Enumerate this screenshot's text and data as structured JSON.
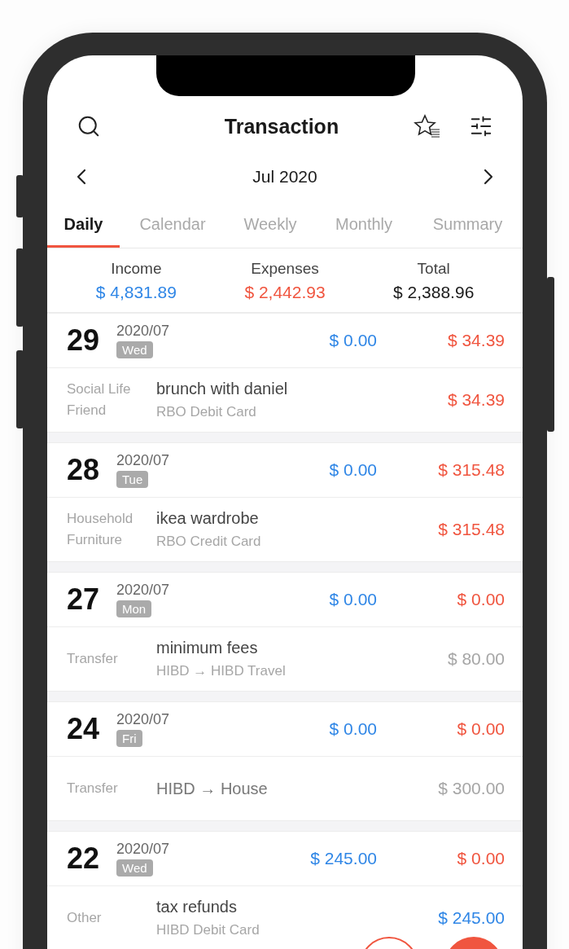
{
  "header": {
    "title": "Transaction"
  },
  "month": {
    "label": "Jul 2020"
  },
  "tabs": [
    {
      "label": "Daily",
      "selected": true
    },
    {
      "label": "Calendar",
      "selected": false
    },
    {
      "label": "Weekly",
      "selected": false
    },
    {
      "label": "Monthly",
      "selected": false
    },
    {
      "label": "Summary",
      "selected": false
    }
  ],
  "summary": [
    {
      "label": "Income",
      "value": "$ 4,831.89",
      "kind": "income"
    },
    {
      "label": "Expenses",
      "value": "$ 2,442.93",
      "kind": "expense"
    },
    {
      "label": "Total",
      "value": "$ 2,388.96",
      "kind": "total"
    }
  ],
  "days": [
    {
      "day": "29",
      "date": "2020/07",
      "weekday": "Wed",
      "income": "$ 0.00",
      "expense": "$ 34.39",
      "transactions": [
        {
          "category": "Social Life",
          "subcategory": "Friend",
          "title": "brunch with daniel",
          "account": "RBO Debit Card",
          "amount": "$ 34.39",
          "kind": "expense"
        }
      ]
    },
    {
      "day": "28",
      "date": "2020/07",
      "weekday": "Tue",
      "income": "$ 0.00",
      "expense": "$ 315.48",
      "transactions": [
        {
          "category": "Household",
          "subcategory": "Furniture",
          "title": "ikea wardrobe",
          "account": "RBO Credit Card",
          "amount": "$ 315.48",
          "kind": "expense"
        }
      ]
    },
    {
      "day": "27",
      "date": "2020/07",
      "weekday": "Mon",
      "income": "$ 0.00",
      "expense": "$ 0.00",
      "transactions": [
        {
          "category": "Transfer",
          "title": "minimum fees",
          "account": "HIBD → HIBD Travel",
          "amount": "$ 80.00",
          "kind": "transfer"
        }
      ]
    },
    {
      "day": "24",
      "date": "2020/07",
      "weekday": "Fri",
      "income": "$ 0.00",
      "expense": "$ 0.00",
      "transactions": [
        {
          "category": "Transfer",
          "title": "HIBD → House",
          "amount": "$ 300.00",
          "kind": "transfer"
        }
      ]
    },
    {
      "day": "22",
      "date": "2020/07",
      "weekday": "Wed",
      "income": "$ 245.00",
      "expense": "$ 0.00",
      "transactions": [
        {
          "category": "Other",
          "title": "tax refunds",
          "account": "HIBD Debit Card",
          "amount": "$ 245.00",
          "kind": "income"
        }
      ]
    }
  ]
}
